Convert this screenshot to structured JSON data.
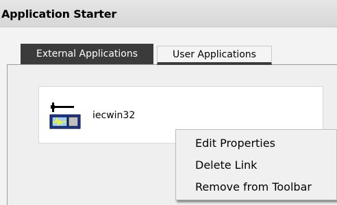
{
  "window": {
    "title": "Application Starter"
  },
  "tabs": [
    {
      "label": "External Applications",
      "active": true
    },
    {
      "label": "User Applications",
      "active": false
    }
  ],
  "applications": [
    {
      "label": "iecwin32",
      "icon": "hammer-oscilloscope-icon"
    }
  ],
  "context_menu": {
    "items": [
      {
        "label": "Edit Properties"
      },
      {
        "label": "Delete Link"
      },
      {
        "label": "Remove from Toolbar"
      }
    ]
  },
  "colors": {
    "active_tab_bg": "#3b3b3b",
    "active_tab_text": "#ffffff",
    "panel_bg": "#efefef",
    "menu_bg": "#f0f0f0",
    "icon_blue": "#1a3fbf",
    "icon_screen": "#9ecfff",
    "icon_wave": "#ffff00"
  }
}
